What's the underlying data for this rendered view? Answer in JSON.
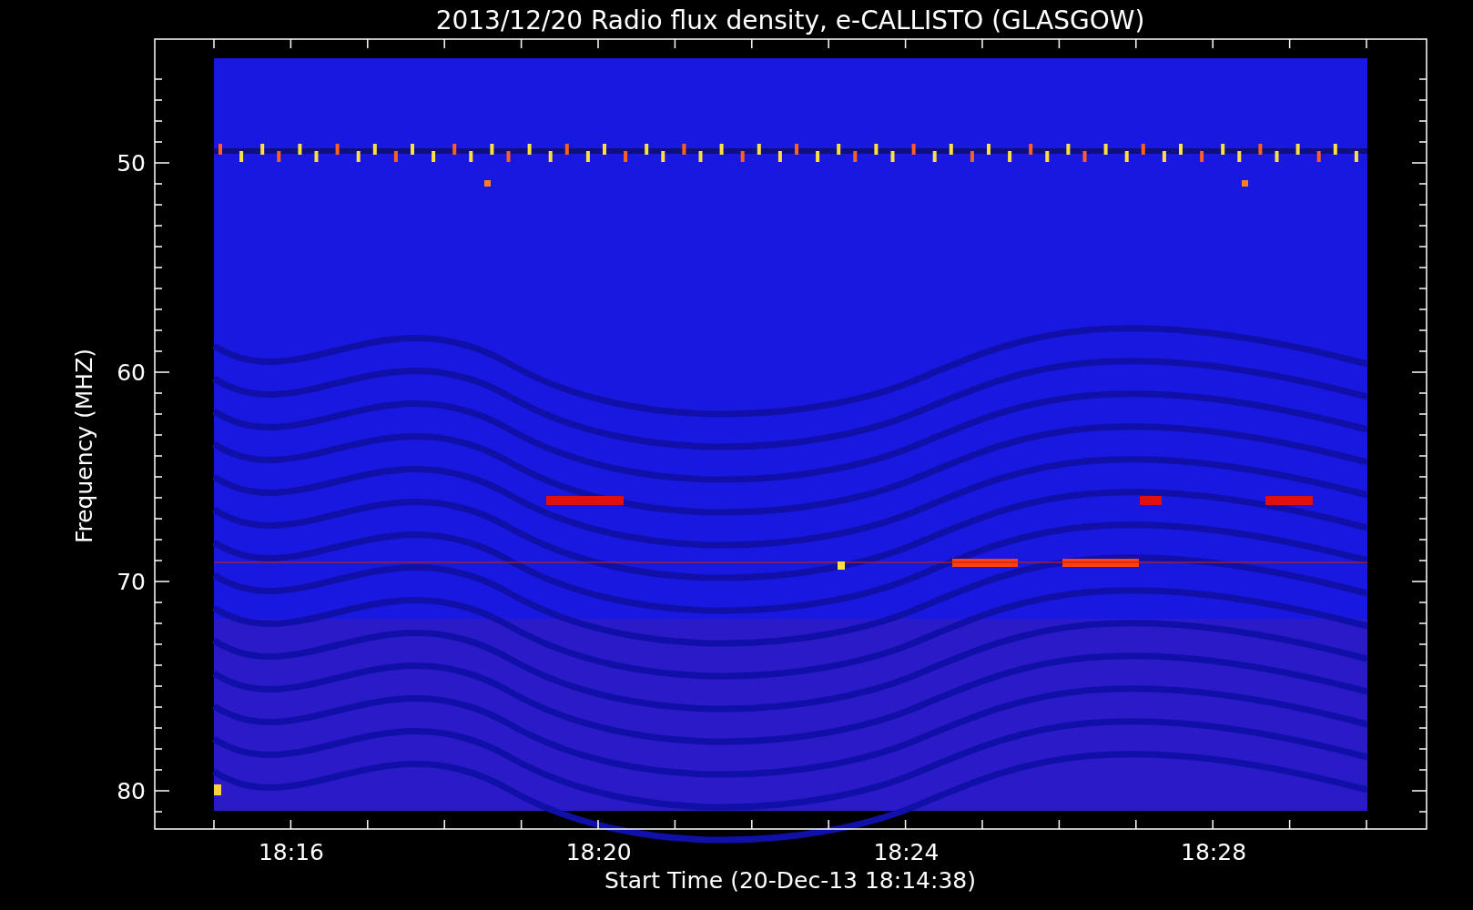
{
  "title": "2013/12/20  Radio flux density, e-CALLISTO (GLASGOW)",
  "y_axis": {
    "label": "Frequency (MHZ)",
    "ticks": [
      "50",
      "60",
      "70",
      "80"
    ]
  },
  "x_axis": {
    "label": "Start Time (20-Dec-13 18:14:38)",
    "ticks": [
      "18:16",
      "18:20",
      "18:24",
      "18:28"
    ]
  }
}
